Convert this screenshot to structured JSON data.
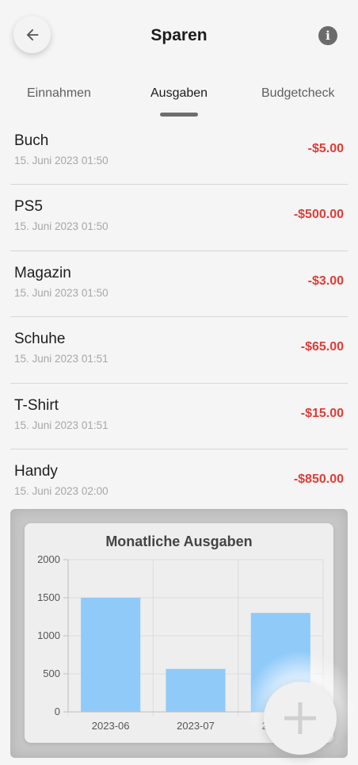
{
  "header": {
    "title": "Sparen",
    "back_icon": "arrow-left-icon",
    "info_icon": "info-icon",
    "info_glyph": "i"
  },
  "tabs": [
    {
      "label": "Einnahmen",
      "active": false
    },
    {
      "label": "Ausgaben",
      "active": true
    },
    {
      "label": "Budgetcheck",
      "active": false
    }
  ],
  "expenses": [
    {
      "name": "Buch",
      "date": "15. Juni 2023 01:50",
      "amount": "-$5.00"
    },
    {
      "name": "PS5",
      "date": "15. Juni 2023 01:50",
      "amount": "-$500.00"
    },
    {
      "name": "Magazin",
      "date": "15. Juni 2023 01:50",
      "amount": "-$3.00"
    },
    {
      "name": "Schuhe",
      "date": "15. Juni 2023 01:51",
      "amount": "-$65.00"
    },
    {
      "name": "T-Shirt",
      "date": "15. Juni 2023 01:51",
      "amount": "-$15.00"
    },
    {
      "name": "Handy",
      "date": "15. Juni 2023 02:00",
      "amount": "-$850.00"
    }
  ],
  "colors": {
    "amount": "#e33b35",
    "bar": "#90caf9"
  },
  "chart_data": {
    "type": "bar",
    "title": "Monatliche Ausgaben",
    "categories": [
      "2023-06",
      "2023-07",
      "2023-08"
    ],
    "values": [
      1500,
      565,
      1300
    ],
    "ylim": [
      0,
      2000
    ],
    "yticks": [
      0,
      500,
      1000,
      1500,
      2000
    ],
    "xlabel": "",
    "ylabel": "",
    "grid": true
  },
  "fab": {
    "icon": "plus-icon"
  }
}
